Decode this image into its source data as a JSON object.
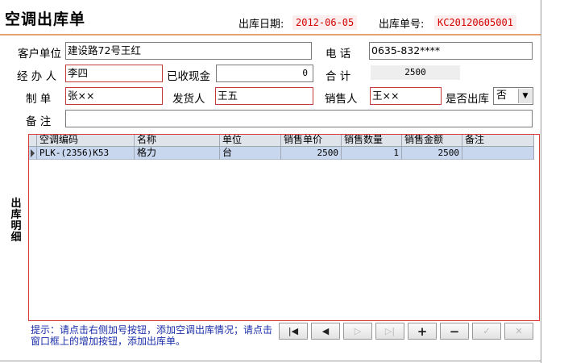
{
  "header": {
    "title": "空调出库单",
    "date_label": "出库日期:",
    "date_value": "2012-06-05",
    "order_label": "出库单号:",
    "order_value": "KC20120605001"
  },
  "form": {
    "customer_label": "客户单位",
    "customer_value": "建设路72号王红",
    "phone_label": "电  话",
    "phone_value": "0635-832****",
    "handler_label": "经 办 人",
    "handler_value": "李四",
    "cash_label": "已收现金",
    "cash_value": "0",
    "total_label": "合  计",
    "total_value": "2500",
    "maker_label": "制  单",
    "maker_value": "张××",
    "shipper_label": "发货人",
    "shipper_value": "王五",
    "sales_label": "销售人",
    "sales_value": "王××",
    "outbound_label": "是否出库",
    "outbound_value": "否",
    "remark_label": "备  注",
    "remark_value": ""
  },
  "detail": {
    "side_title": "出库明细",
    "columns": [
      "空调编码",
      "名称",
      "单位",
      "销售单价",
      "销售数量",
      "销售金额",
      "备注"
    ],
    "rows": [
      [
        "PLK-(2356)K53",
        "格力",
        "台",
        "2500",
        "1",
        "2500",
        ""
      ]
    ]
  },
  "hint": "提示：请点击右侧加号按钮，添加空调出库情况；请点击窗口框上的增加按钮，添加出库单。",
  "nav_buttons": {
    "first": "|◀",
    "prev": "◀",
    "next": "▷",
    "last": "▷|",
    "add": "+",
    "delete": "−",
    "confirm": "✓",
    "cancel": "✕"
  },
  "colors": {
    "accent_line": "#e8a070",
    "red_value": "#d40000",
    "selected_row": "#c9d7ee",
    "hint_text": "#1a2ea8"
  }
}
